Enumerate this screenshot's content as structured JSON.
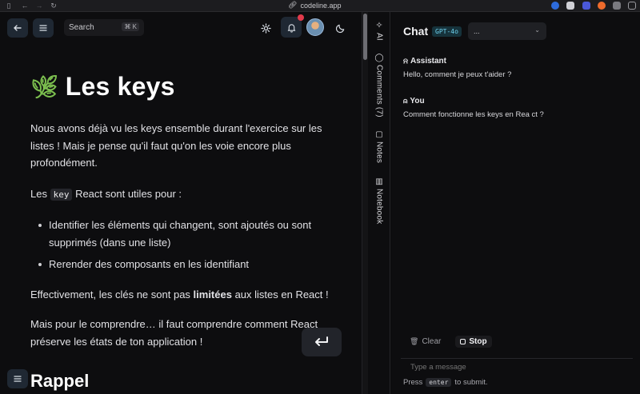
{
  "browser": {
    "url": "codeline.app"
  },
  "topbar": {
    "search_placeholder": "Search",
    "search_shortcut": "⌘ K"
  },
  "doc": {
    "title": "Les keys",
    "p1": "Nous avons déjà vu les keys ensemble durant l'exercice sur les listes ! Mais je pense qu'il faut qu'on les voie encore plus profondément.",
    "p2_before": "Les ",
    "p2_code": "key",
    "p2_after": " React sont utiles pour :",
    "bullets": [
      "Identifier les éléments qui changent, sont ajoutés ou sont supprimés (dans une liste)",
      "Rerender des composants en les identifiant"
    ],
    "p3_before": "Effectivement, les clés ne sont pas ",
    "p3_bold": "limitées",
    "p3_after": " aux listes en React !",
    "p4": "Mais pour le comprendre… il faut comprendre comment React préserve les états de ton application !",
    "h2_partial": "Rappel"
  },
  "vtabs": {
    "ai": "AI",
    "comments": "Comments (7)",
    "notes": "Notes",
    "notebook": "Notebook"
  },
  "chat": {
    "title": "Chat",
    "model": "GPT-4o",
    "model_select": "...",
    "messages": [
      {
        "role": "Assistant",
        "text": "Hello, comment je peux t'aider ?"
      },
      {
        "role": "You",
        "text": "Comment fonctionne les keys en Rea ct ?"
      }
    ],
    "clear_label": "Clear",
    "stop_label": "Stop",
    "input_placeholder": "Type a message",
    "hint_before": "Press",
    "hint_key": "enter",
    "hint_after": "to submit."
  }
}
